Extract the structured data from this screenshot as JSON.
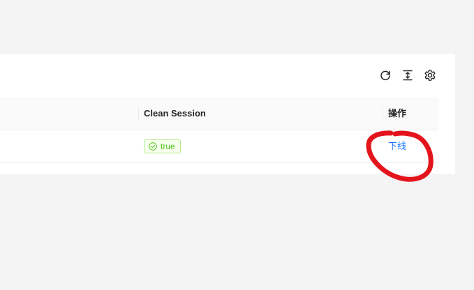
{
  "toolbar": {
    "icons": [
      "reload-icon",
      "column-height-icon",
      "setting-icon"
    ]
  },
  "table": {
    "columns": [
      {
        "label": "Clean Session"
      },
      {
        "label": "操作"
      }
    ],
    "rows": [
      {
        "clean_session": "true",
        "clean_session_icon": "check-circle-icon",
        "action_label": "下线"
      }
    ]
  },
  "colors": {
    "success": "#52c41a",
    "link": "#1677ff",
    "annotation": "#e4141c"
  }
}
